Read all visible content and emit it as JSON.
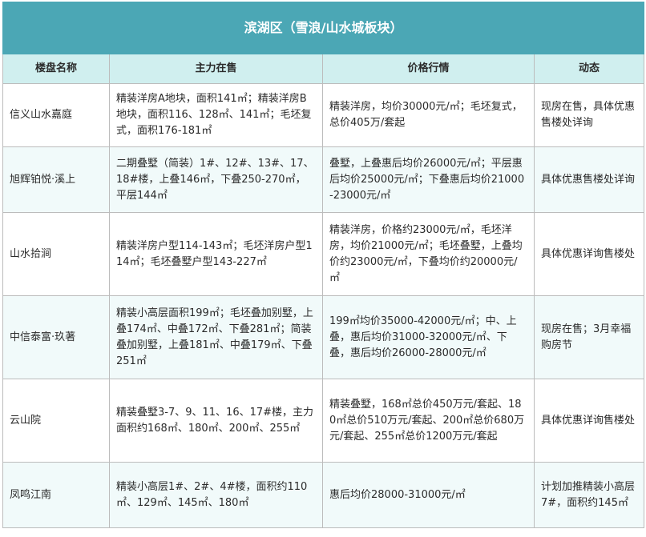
{
  "table": {
    "title": "滨湖区（雪浪/山水城板块）",
    "headers": [
      "楼盘名称",
      "主力在售",
      "价格行情",
      "动态"
    ],
    "rows": [
      {
        "name": "信义山水嘉庭",
        "main": "精装洋房A地块，面积141㎡；精装洋房B地块，面积116、128㎡、141㎡；毛坯复式，面积176-181㎡",
        "price": "精装洋房，均价30000元/㎡；毛坯复式，总价405万/套起",
        "news": "现房在售，具体优惠售楼处详询"
      },
      {
        "name": "旭辉铂悦·溪上",
        "main": "二期叠墅（简装）1#、12#、13#、17、18#楼，上叠146㎡，下叠250-270㎡，平层144㎡",
        "price": "叠墅，上叠惠后均价26000元/㎡；平层惠后均价25000元/㎡；下叠惠后均价21000-23000元/㎡",
        "news": "具体优惠售楼处详询"
      },
      {
        "name": "山水拾涧",
        "main": "精装洋房户型114-143㎡；毛坯洋房户型114㎡；毛坯叠墅户型143-227㎡",
        "price": "精装洋房，价格约23000元/㎡，毛坯洋房，均价21000元/㎡；毛坯叠墅，上叠均价约23000元/㎡，下叠均价约20000元/㎡",
        "news": "具体优惠详询售楼处"
      },
      {
        "name": "中信泰富·玖著",
        "main": "精装小高层面积199㎡；毛坯叠加别墅，上叠174㎡、中叠172㎡、下叠281㎡；简装叠加别墅，上叠181㎡、中叠179㎡、下叠251㎡",
        "price": "199㎡均价35000-42000元/㎡；中、上叠，惠后均价31000-32000元/㎡、下叠，惠后均价26000-28000元/㎡",
        "news": "现房在售；3月幸福购房节"
      },
      {
        "name": "云山院",
        "main": "精装叠墅3-7、9、11、16、17#楼，主力面积约168㎡、180㎡、200㎡、255㎡",
        "price": "精装叠墅，168㎡总价450万元/套起、180㎡总价510万元/套起、200㎡总价680万元/套起、255㎡总价1200万元/套起",
        "news": "具体优惠详询售楼处"
      },
      {
        "name": "凤鸣江南",
        "main": "精装小高层1#、2#、4#楼，面积约110㎡、129㎡、145㎡、180㎡",
        "price": "惠后均价28000-31000元/㎡",
        "news": "计划加推精装小高层7#，面积约145㎡"
      }
    ]
  }
}
